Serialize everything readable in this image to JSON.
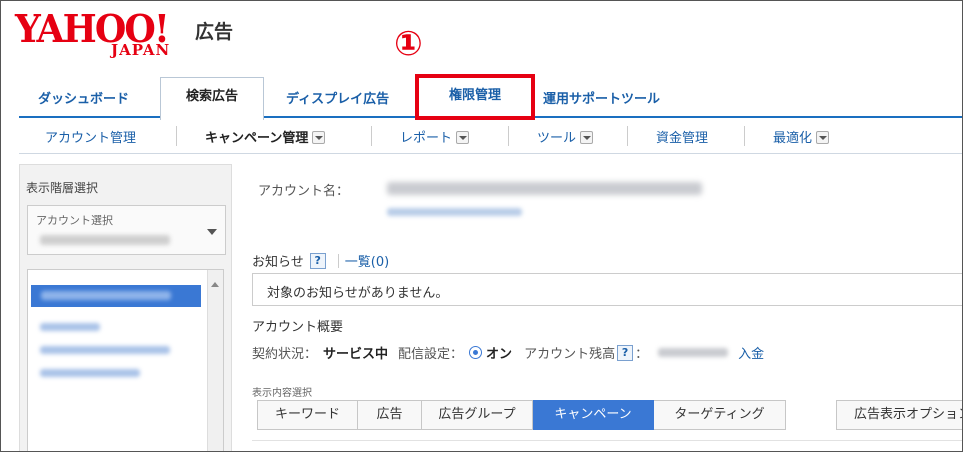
{
  "header": {
    "logo_text": "YAHOO!",
    "logo_sub": "JAPAN",
    "logo_suffix": "広告",
    "annotation_marker": "①"
  },
  "main_tabs": [
    {
      "label": "ダッシュボード",
      "active": false
    },
    {
      "label": "検索広告",
      "active": true
    },
    {
      "label": "ディスプレイ広告",
      "active": false
    },
    {
      "label": "権限管理",
      "active": false,
      "highlighted": true
    },
    {
      "label": "運用サポートツール",
      "active": false
    }
  ],
  "sub_nav": [
    {
      "label": "アカウント管理",
      "dropdown": false,
      "bold": false
    },
    {
      "label": "キャンペーン管理",
      "dropdown": true,
      "bold": true
    },
    {
      "label": "レポート",
      "dropdown": true,
      "bold": false
    },
    {
      "label": "ツール",
      "dropdown": true,
      "bold": false
    },
    {
      "label": "資金管理",
      "dropdown": false,
      "bold": false
    },
    {
      "label": "最適化",
      "dropdown": true,
      "bold": false
    }
  ],
  "left_panel": {
    "title": "表示階層選択",
    "account_select_label": "アカウント選択"
  },
  "content": {
    "account_name_label": "アカウント名：",
    "notice_label": "お知らせ",
    "help_mark": "?",
    "notice_list_link": "一覧(0)",
    "notice_message": "対象のお知らせがありません。",
    "overview_title": "アカウント概要",
    "contract_status_label": "契約状況：",
    "contract_status_value": "サービス中",
    "delivery_label": "配信設定：",
    "delivery_value": "オン",
    "balance_label": "アカウント残高",
    "balance_colon": "：",
    "deposit_link": "入金",
    "display_select_label": "表示内容選択",
    "display_tabs": [
      {
        "label": "キーワード",
        "active": false
      },
      {
        "label": "広告",
        "active": false
      },
      {
        "label": "広告グループ",
        "active": false
      },
      {
        "label": "キャンペーン",
        "active": true
      },
      {
        "label": "ターゲティング",
        "active": false
      }
    ],
    "display_option_label": "広告表示オプション"
  },
  "colors": {
    "brand_red": "#e60012",
    "link_blue": "#1a5fa8",
    "active_blue": "#3a78d4"
  }
}
